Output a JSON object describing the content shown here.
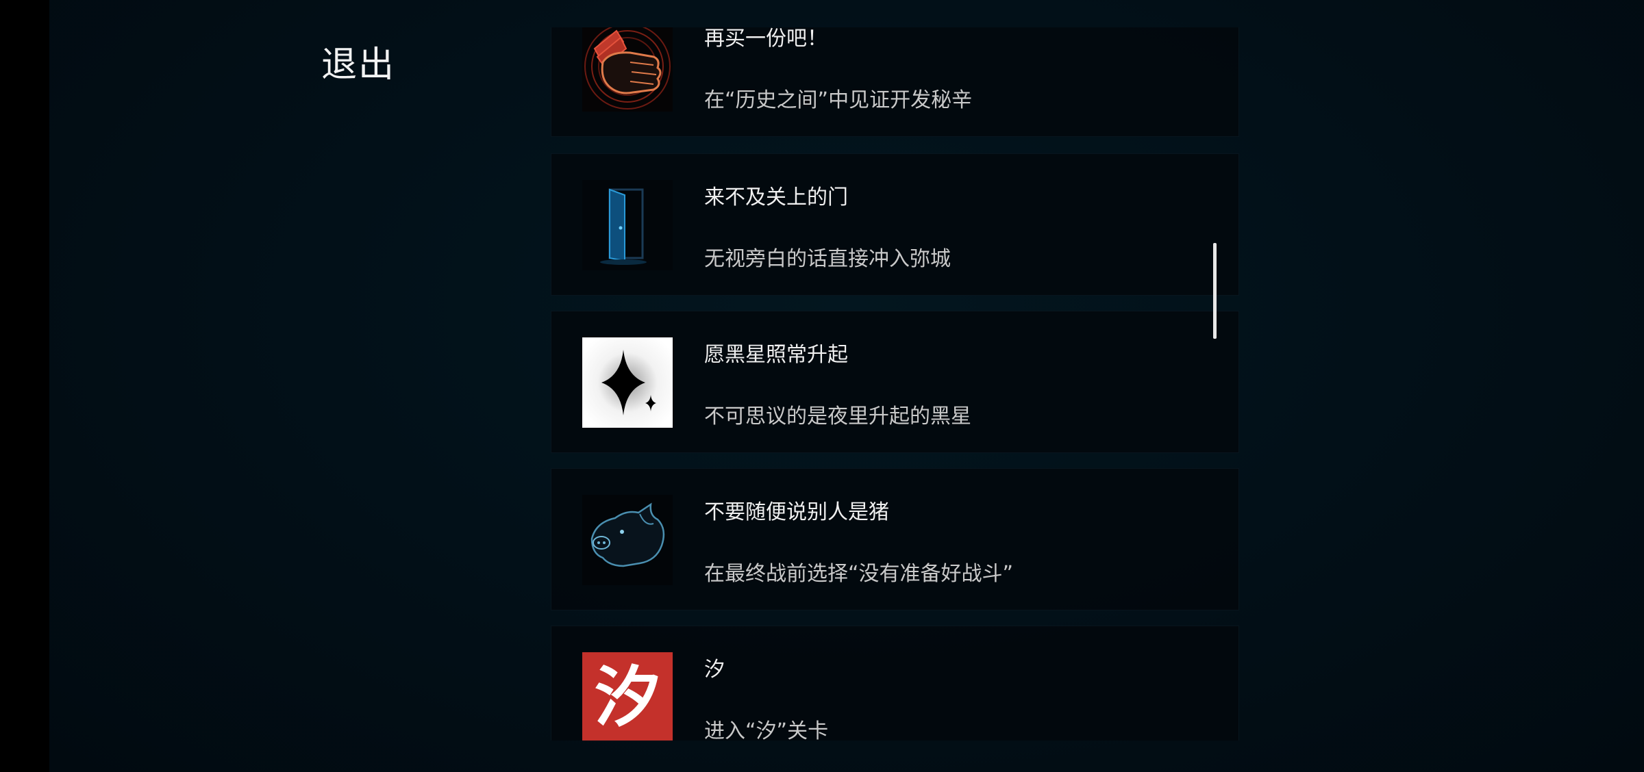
{
  "header": {
    "exit_label": "退出"
  },
  "achievements": [
    {
      "title": "再买一份吧！",
      "description": "在“历史之间”中见证开发秘辛",
      "icon": "fist-money-icon"
    },
    {
      "title": "来不及关上的门",
      "description": "无视旁白的话直接冲入弥城",
      "icon": "open-door-icon"
    },
    {
      "title": "愿黑星照常升起",
      "description": "不可思议的是夜里升起的黑星",
      "icon": "black-star-icon"
    },
    {
      "title": "不要随便说别人是猪",
      "description": "在最终战前选择“没有准备好战斗”",
      "icon": "pig-head-icon"
    },
    {
      "title": "汐",
      "description": "进入“汐”关卡",
      "icon": "xi-character-icon",
      "icon_glyph": "汐"
    }
  ],
  "colors": {
    "background": "#020f17",
    "card": "#02080c",
    "title_text": "#f0f0f0",
    "desc_text": "#c9c9c9",
    "xi_badge": "#c4312b"
  }
}
